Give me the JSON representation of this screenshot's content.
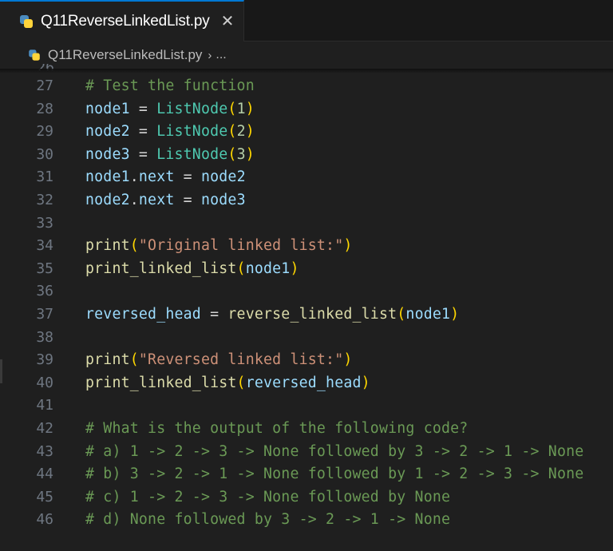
{
  "tab": {
    "title": "Q11ReverseLinkedList.py",
    "close_glyph": "✕",
    "icon": "python-icon"
  },
  "breadcrumb": {
    "file": "Q11ReverseLinkedList.py",
    "separator": "›",
    "more": "..."
  },
  "partial_line_number": "26",
  "colors": {
    "accent": "#0078d4",
    "comment": "#6a9955",
    "string": "#ce9178",
    "function": "#dcdcaa",
    "class": "#4ec9b0",
    "variable": "#9cdcfe",
    "number": "#b5cea8"
  },
  "lines": [
    {
      "n": "27",
      "tokens": [
        {
          "t": "# Test the function",
          "c": "t-com"
        }
      ]
    },
    {
      "n": "28",
      "tokens": [
        {
          "t": "node1",
          "c": "t-var"
        },
        {
          "t": " = ",
          "c": "t-op"
        },
        {
          "t": "ListNode",
          "c": "t-cls"
        },
        {
          "t": "(",
          "c": "p1"
        },
        {
          "t": "1",
          "c": "t-num"
        },
        {
          "t": ")",
          "c": "p1"
        }
      ]
    },
    {
      "n": "29",
      "tokens": [
        {
          "t": "node2",
          "c": "t-var"
        },
        {
          "t": " = ",
          "c": "t-op"
        },
        {
          "t": "ListNode",
          "c": "t-cls"
        },
        {
          "t": "(",
          "c": "p1"
        },
        {
          "t": "2",
          "c": "t-num"
        },
        {
          "t": ")",
          "c": "p1"
        }
      ]
    },
    {
      "n": "30",
      "tokens": [
        {
          "t": "node3",
          "c": "t-var"
        },
        {
          "t": " = ",
          "c": "t-op"
        },
        {
          "t": "ListNode",
          "c": "t-cls"
        },
        {
          "t": "(",
          "c": "p1"
        },
        {
          "t": "3",
          "c": "t-num"
        },
        {
          "t": ")",
          "c": "p1"
        }
      ]
    },
    {
      "n": "31",
      "tokens": [
        {
          "t": "node1",
          "c": "t-var"
        },
        {
          "t": ".",
          "c": "t-op"
        },
        {
          "t": "next",
          "c": "t-var"
        },
        {
          "t": " = ",
          "c": "t-op"
        },
        {
          "t": "node2",
          "c": "t-var"
        }
      ]
    },
    {
      "n": "32",
      "tokens": [
        {
          "t": "node2",
          "c": "t-var"
        },
        {
          "t": ".",
          "c": "t-op"
        },
        {
          "t": "next",
          "c": "t-var"
        },
        {
          "t": " = ",
          "c": "t-op"
        },
        {
          "t": "node3",
          "c": "t-var"
        }
      ]
    },
    {
      "n": "33",
      "tokens": []
    },
    {
      "n": "34",
      "tokens": [
        {
          "t": "print",
          "c": "t-fn"
        },
        {
          "t": "(",
          "c": "p1"
        },
        {
          "t": "\"Original linked list:\"",
          "c": "t-str"
        },
        {
          "t": ")",
          "c": "p1"
        }
      ]
    },
    {
      "n": "35",
      "tokens": [
        {
          "t": "print_linked_list",
          "c": "t-fn"
        },
        {
          "t": "(",
          "c": "p1"
        },
        {
          "t": "node1",
          "c": "t-var"
        },
        {
          "t": ")",
          "c": "p1"
        }
      ]
    },
    {
      "n": "36",
      "tokens": []
    },
    {
      "n": "37",
      "tokens": [
        {
          "t": "reversed_head",
          "c": "t-var"
        },
        {
          "t": " = ",
          "c": "t-op"
        },
        {
          "t": "reverse_linked_list",
          "c": "t-fn"
        },
        {
          "t": "(",
          "c": "p1"
        },
        {
          "t": "node1",
          "c": "t-var"
        },
        {
          "t": ")",
          "c": "p1"
        }
      ]
    },
    {
      "n": "38",
      "tokens": []
    },
    {
      "n": "39",
      "tokens": [
        {
          "t": "print",
          "c": "t-fn"
        },
        {
          "t": "(",
          "c": "p1"
        },
        {
          "t": "\"Reversed linked list:\"",
          "c": "t-str"
        },
        {
          "t": ")",
          "c": "p1"
        }
      ]
    },
    {
      "n": "40",
      "tokens": [
        {
          "t": "print_linked_list",
          "c": "t-fn"
        },
        {
          "t": "(",
          "c": "p1"
        },
        {
          "t": "reversed_head",
          "c": "t-var"
        },
        {
          "t": ")",
          "c": "p1"
        }
      ]
    },
    {
      "n": "41",
      "tokens": []
    },
    {
      "n": "42",
      "tokens": [
        {
          "t": "# What is the output of the following code?",
          "c": "t-com"
        }
      ]
    },
    {
      "n": "43",
      "tokens": [
        {
          "t": "# a) 1 -> 2 -> 3 -> None followed by 3 -> 2 -> 1 -> None",
          "c": "t-com"
        }
      ]
    },
    {
      "n": "44",
      "tokens": [
        {
          "t": "# b) 3 -> 2 -> 1 -> None followed by 1 -> 2 -> 3 -> None",
          "c": "t-com"
        }
      ]
    },
    {
      "n": "45",
      "tokens": [
        {
          "t": "# c) 1 -> 2 -> 3 -> None followed by None",
          "c": "t-com"
        }
      ]
    },
    {
      "n": "46",
      "tokens": [
        {
          "t": "# d) None followed by 3 -> 2 -> 1 -> None",
          "c": "t-com"
        }
      ]
    }
  ]
}
